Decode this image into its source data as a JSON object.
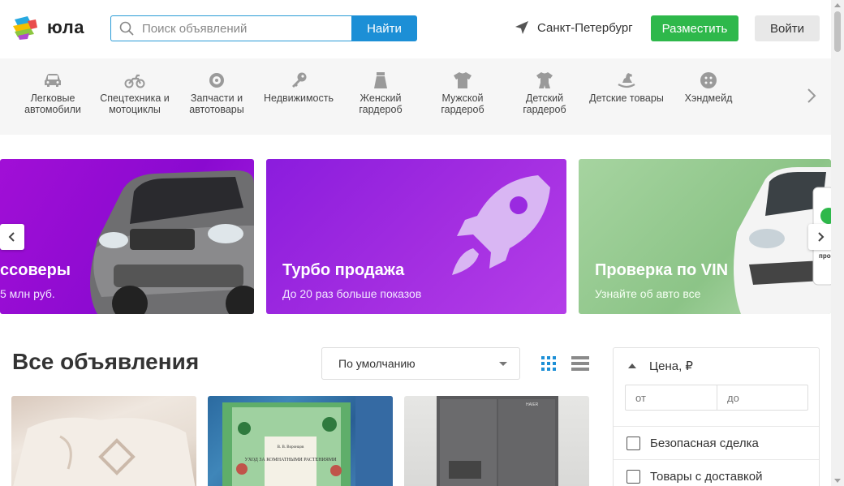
{
  "header": {
    "logo_text": "юла",
    "search_placeholder": "Поиск объявлений",
    "search_button": "Найти",
    "location": "Санкт-Петербург",
    "post_button": "Разместить",
    "login_button": "Войти"
  },
  "categories": [
    {
      "label": "Легковые автомобили",
      "icon": "car-icon"
    },
    {
      "label": "Спецтехника и мотоциклы",
      "icon": "motorcycle-icon"
    },
    {
      "label": "Запчасти и автотовары",
      "icon": "wheel-icon"
    },
    {
      "label": "Недвижимость",
      "icon": "key-icon"
    },
    {
      "label": "Женский гардероб",
      "icon": "skirt-icon"
    },
    {
      "label": "Мужской гардероб",
      "icon": "tshirt-icon"
    },
    {
      "label": "Детский гардероб",
      "icon": "baby-clothes-icon"
    },
    {
      "label": "Детские товары",
      "icon": "rocking-horse-icon"
    },
    {
      "label": "Хэндмейд",
      "icon": "button-icon"
    }
  ],
  "banners": [
    {
      "title": "ссоверы",
      "subtitle": "5 млн руб."
    },
    {
      "title": "Турбо продажа",
      "subtitle": "До 20 раз больше показов"
    },
    {
      "title": "Проверка по VIN",
      "subtitle": "Узнайте об авто все",
      "badge": "про"
    }
  ],
  "listings": {
    "title": "Все объявления",
    "sort_value": "По умолчанию",
    "book_cover_author": "В. В. Воронцов",
    "book_cover_title": "УХОД ЗА КОМНАТНЫМИ РАСТЕНИЯМИ",
    "fridge_brand": "HAIER"
  },
  "filters": {
    "price_title": "Цена, ₽",
    "price_from_placeholder": "от",
    "price_to_placeholder": "до",
    "safe_deal": "Безопасная сделка",
    "with_delivery": "Товары с доставкой"
  },
  "colors": {
    "accent_blue": "#1c8fd6",
    "post_green": "#2eb84b",
    "banner_purple": "#8b1cdd"
  }
}
